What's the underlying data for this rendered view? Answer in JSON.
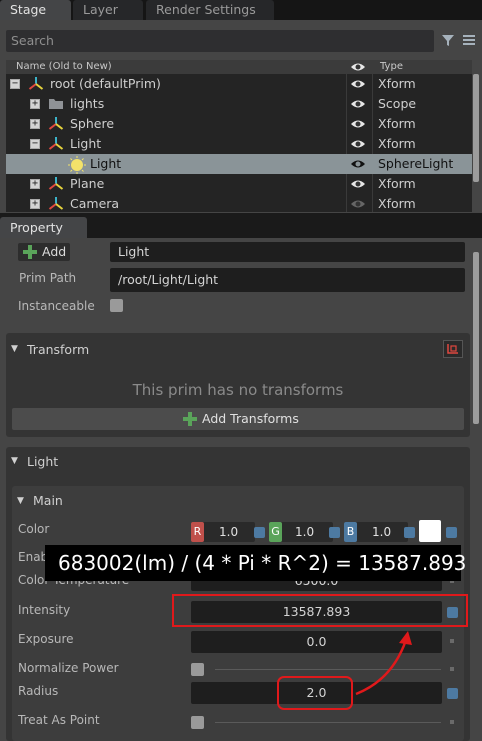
{
  "tabs": [
    {
      "label": "Stage"
    },
    {
      "label": "Layer"
    },
    {
      "label": "Render Settings"
    }
  ],
  "stage": {
    "search_placeholder": "Search",
    "columns": {
      "name": "Name (Old to New)",
      "type": "Type"
    },
    "rows": [
      {
        "name": "root (defaultPrim)",
        "type": "Xform",
        "expand": "−",
        "indent": 0,
        "icon": "xform-icon"
      },
      {
        "name": "lights",
        "type": "Scope",
        "expand": "+",
        "indent": 1,
        "icon": "folder-icon"
      },
      {
        "name": "Sphere",
        "type": "Xform",
        "expand": "+",
        "indent": 1,
        "icon": "xform-icon"
      },
      {
        "name": "Light",
        "type": "Xform",
        "expand": "−",
        "indent": 1,
        "icon": "xform-icon"
      },
      {
        "name": "Light",
        "type": "SphereLight",
        "expand": "",
        "indent": 2,
        "icon": "sphere-light-icon",
        "selected": true
      },
      {
        "name": "Plane",
        "type": "Xform",
        "expand": "+",
        "indent": 1,
        "icon": "xform-icon"
      },
      {
        "name": "Camera",
        "type": "Xform",
        "expand": "+",
        "indent": 1,
        "icon": "xform-icon",
        "eye_hidden": true
      }
    ]
  },
  "property": {
    "tab_label": "Property",
    "add_label": "Add",
    "name_value": "Light",
    "prim_path_label": "Prim Path",
    "prim_path_value": "/root/Light/Light",
    "instanceable_label": "Instanceable",
    "transform": {
      "title": "Transform",
      "empty_msg": "This prim has no transforms",
      "add_label": "Add Transforms"
    },
    "light": {
      "title": "Light",
      "main_title": "Main",
      "color": {
        "label": "Color",
        "r": "1.0",
        "g": "1.0",
        "b": "1.0",
        "r_tag": "R",
        "g_tag": "G",
        "b_tag": "B",
        "swatch": "#ffffff"
      },
      "enable_label": "Enab",
      "color_temp_label": "Color Temperature",
      "color_temp_value": "6500.0",
      "intensity_label": "Intensity",
      "intensity_value": "13587.893",
      "exposure_label": "Exposure",
      "exposure_value": "0.0",
      "normalize_label": "Normalize Power",
      "radius_label": "Radius",
      "radius_value": "2.0",
      "treat_point_label": "Treat As Point"
    }
  },
  "annotation": {
    "formula": "683002(lm) / (4 * Pi * R^2) = 13587.893"
  },
  "colors": {
    "highlight": "#e0191b",
    "xform_red": "#e0473f",
    "xform_teal": "#3bb3c8",
    "xform_yellow": "#e6d43d",
    "add_green": "#5aa45a"
  }
}
